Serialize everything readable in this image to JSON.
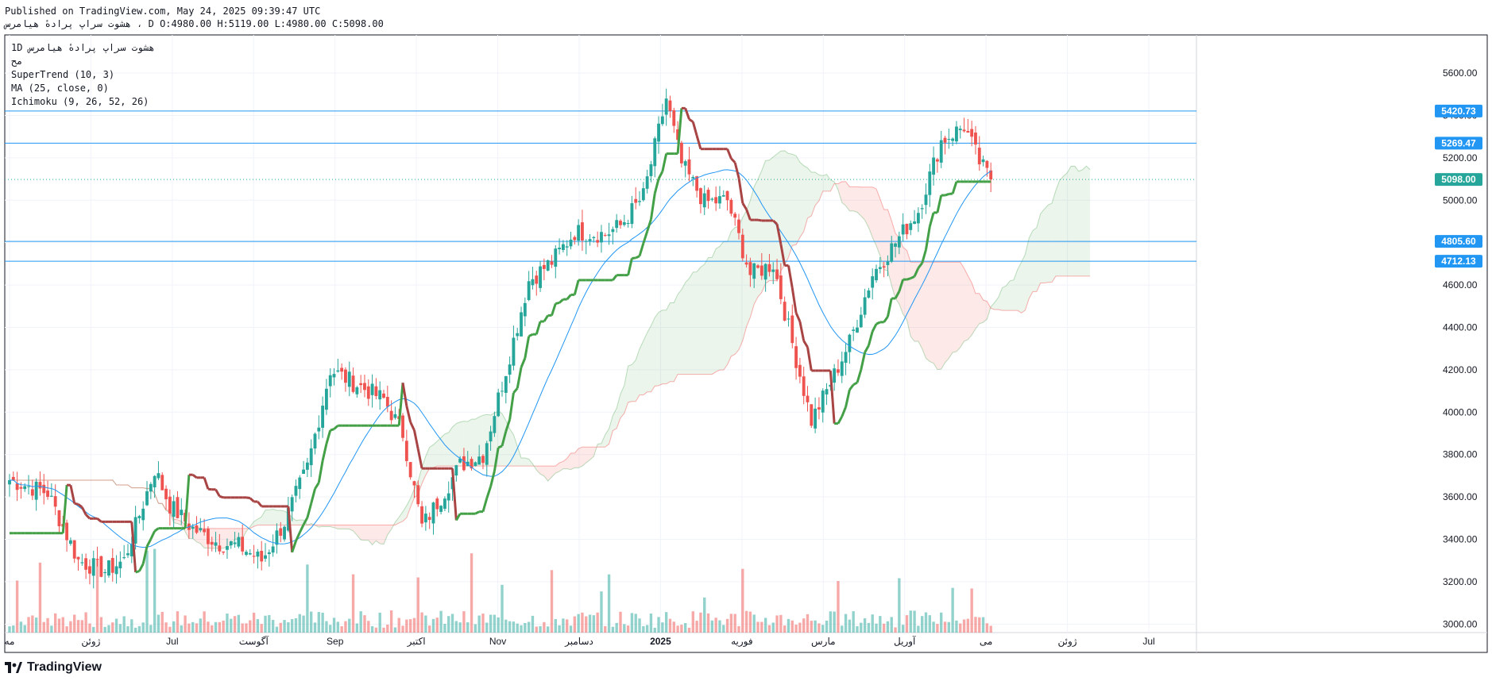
{
  "header": {
    "published": "Published on TradingView.com, May 24, 2025 09:39:47 UTC",
    "ohlc": "هشوت  سراپ  پرادهٔ  هیامرس ، D O:4980.00 H:5119.00 L:4980.00 C:5098.00"
  },
  "legend": {
    "symbol": "1D  هشوت  سراپ  پرادهٔ  هیامرس",
    "sub": "مح",
    "supertrend": "SuperTrend (10, 3)",
    "ma": "MA (25, close, 0)",
    "ichimoku": "Ichimoku (9, 26, 52, 26)"
  },
  "brand": {
    "name": "TradingView",
    "logo_icon": "tradingview-logo-icon"
  },
  "colors": {
    "up": "#26a69a",
    "down": "#ef5350",
    "st_up": "#43a047",
    "st_down": "#a84444",
    "ma": "#2196f3",
    "hline": "#2196f3"
  },
  "chart_data": {
    "type": "candlestick",
    "y_range": [
      2960,
      5780
    ],
    "y_ticks": [
      3000,
      3200,
      3400,
      3600,
      3800,
      4000,
      4200,
      4400,
      4600,
      4800,
      5000,
      5200,
      5400,
      5600
    ],
    "x_labels": [
      "مه",
      "ژوئن",
      "Jul",
      "آگوست",
      "Sep",
      "اکتبر",
      "Nov",
      "دسامبر",
      "2025",
      "فوریه",
      "مارس",
      "آوریل",
      "می",
      "ژوئن",
      "Jul"
    ],
    "horizontal_lines": [
      5420.73,
      5269.47,
      4805.6,
      4712.13
    ],
    "last_price": 5098.0,
    "price_labels": [
      "5420.73",
      "5269.47",
      "5098.00",
      "4805.60",
      "4712.13"
    ],
    "anchors": [
      [
        0,
        3680
      ],
      [
        10,
        3620
      ],
      [
        18,
        3300
      ],
      [
        25,
        3250
      ],
      [
        30,
        3300
      ],
      [
        38,
        3730
      ],
      [
        42,
        3560
      ],
      [
        48,
        3450
      ],
      [
        55,
        3380
      ],
      [
        60,
        3370
      ],
      [
        66,
        3300
      ],
      [
        72,
        3480
      ],
      [
        78,
        3740
      ],
      [
        84,
        4200
      ],
      [
        90,
        4140
      ],
      [
        98,
        4060
      ],
      [
        103,
        3900
      ],
      [
        108,
        3460
      ],
      [
        113,
        3600
      ],
      [
        118,
        3750
      ],
      [
        124,
        3800
      ],
      [
        130,
        4200
      ],
      [
        136,
        4620
      ],
      [
        142,
        4710
      ],
      [
        148,
        4850
      ],
      [
        156,
        4840
      ],
      [
        160,
        4880
      ],
      [
        166,
        5020
      ],
      [
        172,
        5480
      ],
      [
        176,
        5170
      ],
      [
        182,
        4990
      ],
      [
        188,
        5000
      ],
      [
        194,
        4650
      ],
      [
        200,
        4700
      ],
      [
        206,
        4250
      ],
      [
        210,
        3960
      ],
      [
        214,
        4100
      ],
      [
        220,
        4330
      ],
      [
        226,
        4650
      ],
      [
        232,
        4800
      ],
      [
        238,
        4950
      ],
      [
        244,
        5280
      ],
      [
        250,
        5350
      ],
      [
        254,
        5180
      ],
      [
        257,
        5098
      ]
    ],
    "volume_note": "volume histogram along the bottom"
  }
}
